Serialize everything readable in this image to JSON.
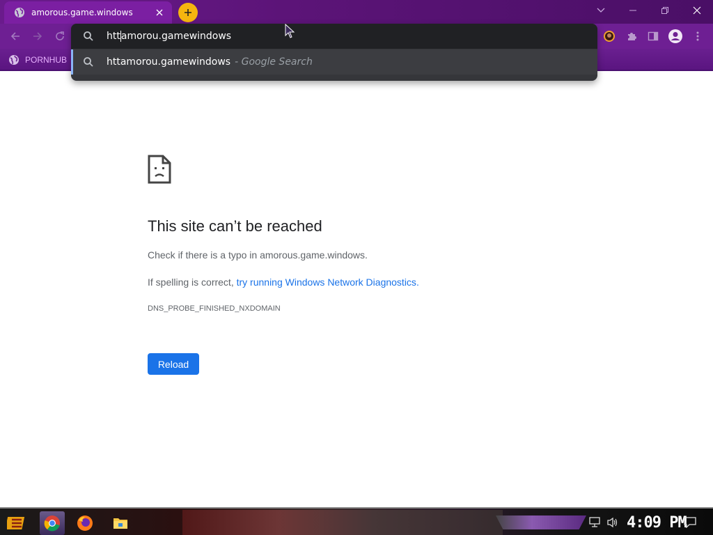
{
  "browser": {
    "tab": {
      "title": "amorous.game.windows"
    },
    "omnibox": {
      "typed_before_caret": "htt",
      "typed_after_caret": "amorou.gamewindows",
      "suggestion_text": "httamorou.gamewindows",
      "suggestion_sub": "- Google Search"
    },
    "bookmarks": [
      {
        "label": "PORNHUB"
      }
    ],
    "theme_color": "#6e1f93",
    "accent_color": "#f5b50f"
  },
  "error_page": {
    "title": "This site can’t be reached",
    "line1": "Check if there is a typo in amorous.game.windows.",
    "line2_prefix": "If spelling is correct,",
    "line2_link": "try running Windows Network Diagnostics",
    "line2_suffix": ".",
    "error_code": "DNS_PROBE_FINISHED_NXDOMAIN",
    "reload_label": "Reload",
    "link_color": "#1a73e8"
  },
  "taskbar": {
    "clock": "4:09 PM",
    "apps": [
      "start",
      "chrome",
      "firefox",
      "file-explorer"
    ]
  }
}
